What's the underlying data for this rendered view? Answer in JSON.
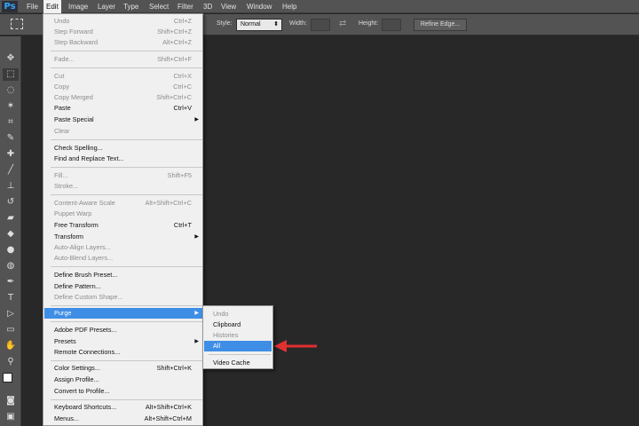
{
  "app": {
    "logo": "Ps"
  },
  "menubar": {
    "items": [
      {
        "label": "File",
        "active": false
      },
      {
        "label": "Edit",
        "active": true
      },
      {
        "label": "Image",
        "active": false
      },
      {
        "label": "Layer",
        "active": false
      },
      {
        "label": "Type",
        "active": false
      },
      {
        "label": "Select",
        "active": false
      },
      {
        "label": "Filter",
        "active": false
      },
      {
        "label": "3D",
        "active": false
      },
      {
        "label": "View",
        "active": false
      },
      {
        "label": "Window",
        "active": false
      },
      {
        "label": "Help",
        "active": false
      }
    ]
  },
  "options": {
    "style_label": "Style:",
    "style_value": "Normal",
    "width_label": "Width:",
    "height_label": "Height:",
    "refine_label": "Refine Edge..."
  },
  "edit_menu": {
    "items": [
      {
        "label": "Undo",
        "shortcut": "Ctrl+Z",
        "enabled": false
      },
      {
        "label": "Step Forward",
        "shortcut": "Shift+Ctrl+Z",
        "enabled": false
      },
      {
        "label": "Step Backward",
        "shortcut": "Alt+Ctrl+Z",
        "enabled": false
      },
      {
        "label": "Fade...",
        "shortcut": "Shift+Ctrl+F",
        "enabled": false
      },
      {
        "label": "Cut",
        "shortcut": "Ctrl+X",
        "enabled": false
      },
      {
        "label": "Copy",
        "shortcut": "Ctrl+C",
        "enabled": false
      },
      {
        "label": "Copy Merged",
        "shortcut": "Shift+Ctrl+C",
        "enabled": false
      },
      {
        "label": "Paste",
        "shortcut": "Ctrl+V",
        "enabled": true
      },
      {
        "label": "Paste Special",
        "shortcut": "",
        "enabled": true,
        "submenu": true
      },
      {
        "label": "Clear",
        "shortcut": "",
        "enabled": false
      },
      {
        "label": "Check Spelling...",
        "shortcut": "",
        "enabled": true
      },
      {
        "label": "Find and Replace Text...",
        "shortcut": "",
        "enabled": true
      },
      {
        "label": "Fill...",
        "shortcut": "Shift+F5",
        "enabled": false
      },
      {
        "label": "Stroke...",
        "shortcut": "",
        "enabled": false
      },
      {
        "label": "Content-Aware Scale",
        "shortcut": "Alt+Shift+Ctrl+C",
        "enabled": false
      },
      {
        "label": "Puppet Warp",
        "shortcut": "",
        "enabled": false
      },
      {
        "label": "Free Transform",
        "shortcut": "Ctrl+T",
        "enabled": true
      },
      {
        "label": "Transform",
        "shortcut": "",
        "enabled": true,
        "submenu": true
      },
      {
        "label": "Auto-Align Layers...",
        "shortcut": "",
        "enabled": false
      },
      {
        "label": "Auto-Blend Layers...",
        "shortcut": "",
        "enabled": false
      },
      {
        "label": "Define Brush Preset...",
        "shortcut": "",
        "enabled": true
      },
      {
        "label": "Define Pattern...",
        "shortcut": "",
        "enabled": true
      },
      {
        "label": "Define Custom Shape...",
        "shortcut": "",
        "enabled": false
      },
      {
        "label": "Purge",
        "shortcut": "",
        "enabled": true,
        "submenu": true,
        "highlighted": true
      },
      {
        "label": "Adobe PDF Presets...",
        "shortcut": "",
        "enabled": true
      },
      {
        "label": "Presets",
        "shortcut": "",
        "enabled": true,
        "submenu": true
      },
      {
        "label": "Remote Connections...",
        "shortcut": "",
        "enabled": true
      },
      {
        "label": "Color Settings...",
        "shortcut": "Shift+Ctrl+K",
        "enabled": true
      },
      {
        "label": "Assign Profile...",
        "shortcut": "",
        "enabled": true
      },
      {
        "label": "Convert to Profile...",
        "shortcut": "",
        "enabled": true
      },
      {
        "label": "Keyboard Shortcuts...",
        "shortcut": "Alt+Shift+Ctrl+K",
        "enabled": true
      },
      {
        "label": "Menus...",
        "shortcut": "Alt+Shift+Ctrl+M",
        "enabled": true
      }
    ]
  },
  "purge_submenu": {
    "items": [
      {
        "label": "Undo",
        "enabled": false
      },
      {
        "label": "Clipboard",
        "enabled": true
      },
      {
        "label": "Histories",
        "enabled": false
      },
      {
        "label": "All",
        "enabled": true,
        "highlighted": true
      },
      {
        "label": "Video Cache",
        "enabled": true
      }
    ]
  },
  "colors": {
    "canvas": "#282828",
    "highlight": "#3f8ee6",
    "annotation_arrow": "#e03030"
  }
}
